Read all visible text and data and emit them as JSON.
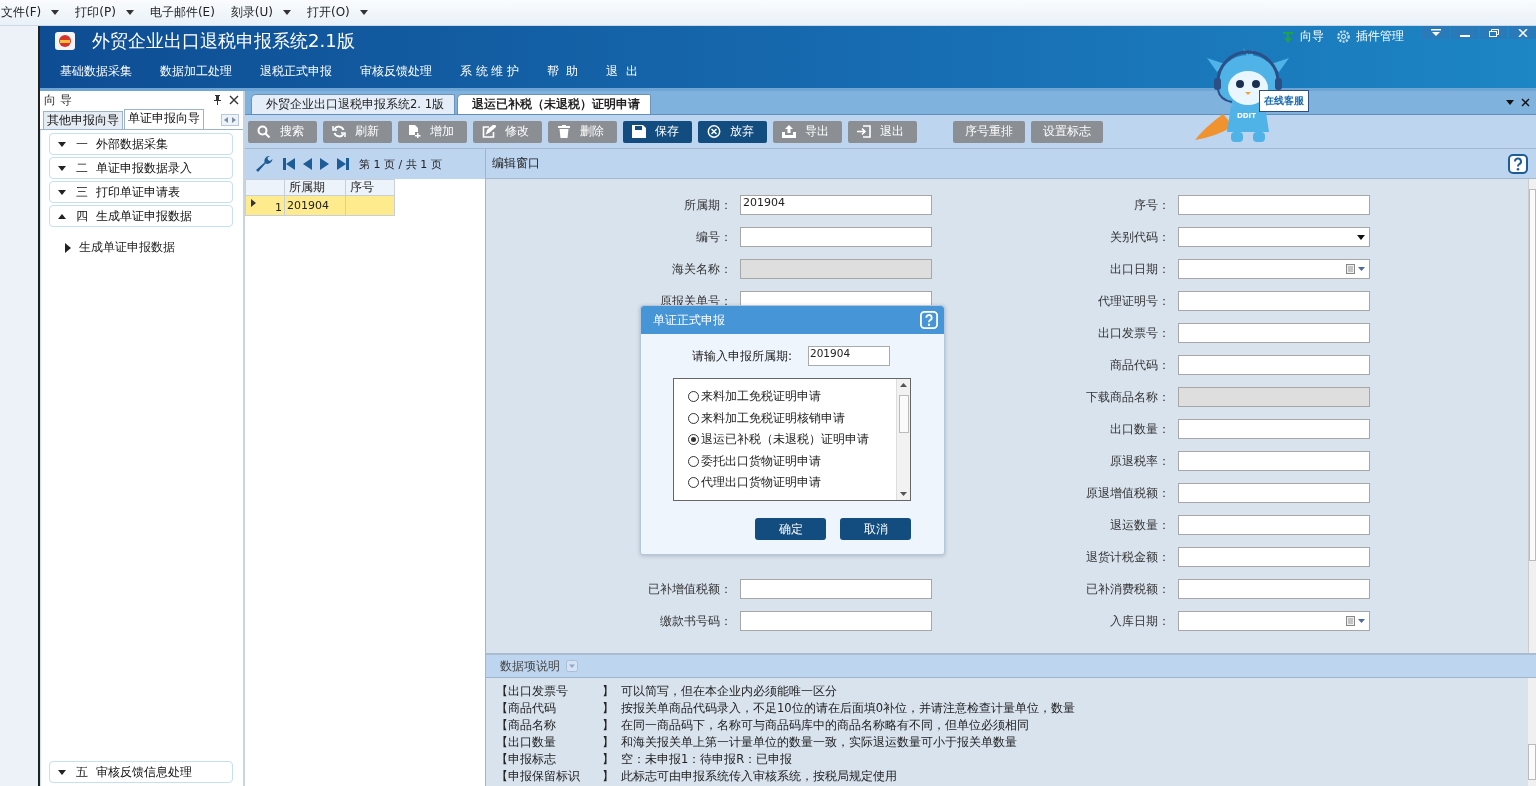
{
  "menubar": [
    {
      "label": "文件(F)",
      "dropdown": true
    },
    {
      "label": "打印(P)",
      "dropdown": true
    },
    {
      "label": "电子邮件(E)",
      "dropdown": false
    },
    {
      "label": "刻录(U)",
      "dropdown": true
    },
    {
      "label": "打开(O)",
      "dropdown": true
    }
  ],
  "app": {
    "title": "外贸企业出口退税申报系统2.1版",
    "top_links": [
      {
        "label": "向导",
        "kind": "pin"
      },
      {
        "label": "插件管理",
        "kind": "gear"
      }
    ],
    "nav": [
      "基础数据采集",
      "数据加工处理",
      "退税正式申报",
      "审核反馈处理",
      "系 统 维 护",
      "帮  助",
      "退  出"
    ]
  },
  "mascot": {
    "sign": "在线客服",
    "badge": "DDIT"
  },
  "guide_panel": {
    "title": "向 导",
    "tabs": [
      {
        "label": "其他申报向导",
        "selected": false
      },
      {
        "label": "单证申报向导",
        "selected": true
      }
    ],
    "sections": [
      {
        "label": "一  外部数据采集",
        "expanded": false
      },
      {
        "label": "二  单证申报数据录入",
        "expanded": false
      },
      {
        "label": "三  打印单证申请表",
        "expanded": false
      },
      {
        "label": "四  生成单证申报数据",
        "expanded": true,
        "children": [
          {
            "label": "生成单证申报数据"
          }
        ]
      }
    ],
    "bottom_sections": [
      {
        "label": "五  审核反馈信息处理",
        "expanded": false
      }
    ]
  },
  "doc_tabs": [
    {
      "label": "外贸企业出口退税申报系统2. 1版",
      "selected": false
    },
    {
      "label": "退运已补税（未退税）证明申请",
      "selected": true
    }
  ],
  "toolbar": [
    {
      "label": "搜索",
      "kind": "search",
      "enabled": false
    },
    {
      "label": "刷新",
      "kind": "refresh",
      "enabled": false
    },
    {
      "label": "增加",
      "kind": "add",
      "enabled": false
    },
    {
      "label": "修改",
      "kind": "edit",
      "enabled": false
    },
    {
      "label": "删除",
      "kind": "delete",
      "enabled": false
    },
    {
      "label": "保存",
      "kind": "save",
      "enabled": true
    },
    {
      "label": "放弃",
      "kind": "cancel",
      "enabled": true
    },
    {
      "label": "导出",
      "kind": "export",
      "enabled": false
    },
    {
      "label": "退出",
      "kind": "exit",
      "enabled": false
    }
  ],
  "toolbar_extra": [
    {
      "label": "序号重排",
      "enabled": false
    },
    {
      "label": "设置标志",
      "enabled": false
    }
  ],
  "pager": {
    "text": "第 1 页 / 共 1 页"
  },
  "grid": {
    "columns": [
      "所属期",
      "序号"
    ],
    "rows": [
      {
        "number": "1",
        "cells": [
          "201904"
        ],
        "selected": true
      }
    ]
  },
  "edit_window": {
    "title": "编辑窗口",
    "left_fields_above": [
      {
        "label": "所属期：",
        "value": "201904",
        "kind": "text"
      },
      {
        "label": "编号：",
        "kind": "text"
      },
      {
        "label": "海关名称：",
        "kind": "readonly"
      },
      {
        "label": "原报关单号：",
        "kind": "text"
      }
    ],
    "left_fields_below": [
      {
        "label": "已补增值税额：",
        "kind": "text"
      },
      {
        "label": "缴款书号码：",
        "kind": "text"
      }
    ],
    "right_fields": [
      {
        "label": "序号：",
        "kind": "text"
      },
      {
        "label": "关别代码：",
        "kind": "select"
      },
      {
        "label": "出口日期：",
        "kind": "date"
      },
      {
        "label": "代理证明号：",
        "kind": "text"
      },
      {
        "label": "出口发票号：",
        "kind": "text"
      },
      {
        "label": "商品代码：",
        "kind": "text"
      },
      {
        "label": "下载商品名称：",
        "kind": "readonly"
      },
      {
        "label": "出口数量：",
        "kind": "text"
      },
      {
        "label": "原退税率：",
        "kind": "text"
      },
      {
        "label": "原退增值税额：",
        "kind": "text"
      },
      {
        "label": "退运数量：",
        "kind": "text"
      },
      {
        "label": "退货计税金额：",
        "kind": "text"
      },
      {
        "label": "已补消费税额：",
        "kind": "text"
      },
      {
        "label": "入库日期：",
        "kind": "date"
      }
    ]
  },
  "data_notes": {
    "title": "数据项说明",
    "rows": [
      {
        "name": "【出口发票号",
        "close": "】",
        "text": "可以简写，但在本企业内必须能唯一区分"
      },
      {
        "name": "【商品代码",
        "close": "】",
        "text": "按报关单商品代码录入，不足10位的请在后面填0补位，并请注意检查计量单位，数量"
      },
      {
        "name": "【商品名称",
        "close": "】",
        "text": "在同一商品码下，名称可与商品码库中的商品名称略有不同，但单位必须相同"
      },
      {
        "name": "【出口数量",
        "close": "】",
        "text": "和海关报关单上第一计量单位的数量一致，实际退运数量可小于报关单数量"
      },
      {
        "name": "【申报标志",
        "close": "】",
        "text": "空：未申报1：待申报R：已申报"
      },
      {
        "name": "【申报保留标识",
        "close": "】",
        "text": "此标志可由申报系统传入审核系统，按税局规定使用"
      }
    ]
  },
  "dialog": {
    "title": "单证正式申报",
    "period_label": "请输入申报所属期:",
    "period_value": "201904",
    "options": [
      {
        "label": "来料加工免税证明申请",
        "selected": false
      },
      {
        "label": "来料加工免税证明核销申请",
        "selected": false
      },
      {
        "label": "退运已补税（未退税）证明申请",
        "selected": true
      },
      {
        "label": "委托出口货物证明申请",
        "selected": false
      },
      {
        "label": "代理出口货物证明申请",
        "selected": false
      }
    ],
    "buttons": [
      "确定",
      "取消"
    ]
  }
}
